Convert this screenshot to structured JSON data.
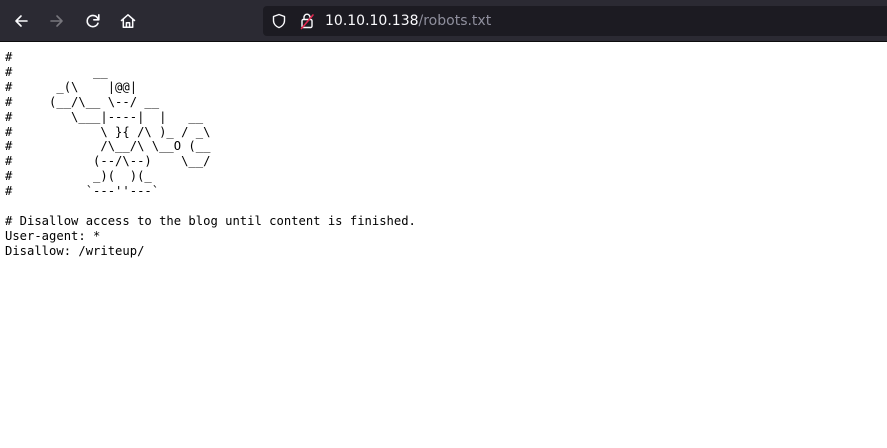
{
  "browser": {
    "url_host": "10.10.10.138",
    "url_path": "/robots.txt",
    "icons": {
      "back": "arrow-left-icon",
      "forward": "arrow-right-icon",
      "reload": "reload-icon",
      "home": "home-icon",
      "tracking": "shield-icon",
      "security": "insecure-lock-icon"
    },
    "colors": {
      "toolbar": "#2b2a33",
      "urlbar": "#1c1b22",
      "insecure_slash": "#e22850"
    }
  },
  "document": {
    "text": "#\n#           __\n#      _(\\    |@@|\n#     (__/\\__ \\--/ __\n#        \\___|----|  |   __\n#            \\ }{ /\\ )_ / _\\\n#            /\\__/\\ \\__O (__\n#           (--/\\--)    \\__/\n#           _)(  )(_\n#          `---''---`\n\n# Disallow access to the blog until content is finished.\nUser-agent: *\nDisallow: /writeup/"
  }
}
